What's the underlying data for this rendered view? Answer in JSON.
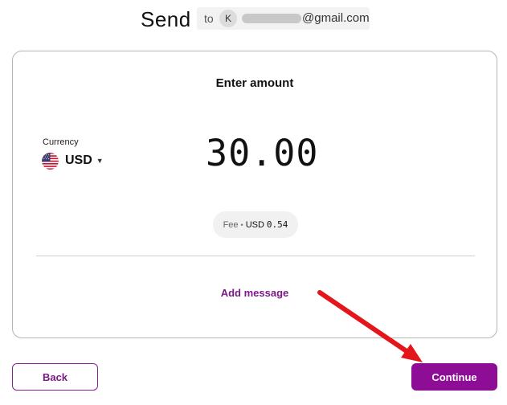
{
  "header": {
    "title": "Send",
    "recipient": {
      "prefix": "to",
      "avatar_initial": "K",
      "email_visible": "@gmail.com"
    }
  },
  "card": {
    "title": "Enter amount",
    "currency": {
      "label": "Currency",
      "code": "USD",
      "flag_icon": "us-flag-icon"
    },
    "amount": "30.00",
    "fee": {
      "label": "Fee",
      "currency": "USD",
      "value": "0.54"
    },
    "add_message_label": "Add message"
  },
  "actions": {
    "back_label": "Back",
    "continue_label": "Continue"
  },
  "colors": {
    "accent": "#8e0d96",
    "annotation_arrow": "#e3161b"
  }
}
